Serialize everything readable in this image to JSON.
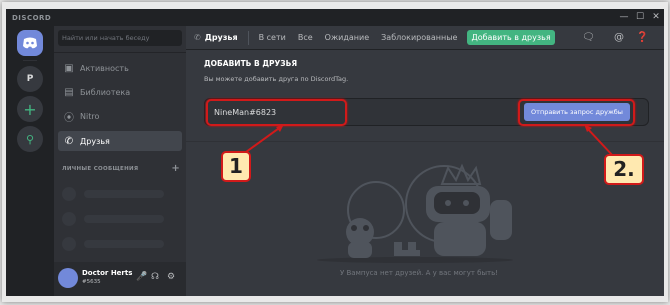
{
  "window": {
    "brand": "DISCORD",
    "controls": [
      "—",
      "☐",
      "✕"
    ]
  },
  "servers": [
    {
      "name": "home",
      "icon": "discord-logo-icon"
    },
    {
      "name": "P"
    },
    {
      "name": "add",
      "label": "+"
    },
    {
      "name": "explore",
      "icon": "search-icon"
    }
  ],
  "sidebar": {
    "search_placeholder": "Найти или начать беседу",
    "items": [
      {
        "label": "Активность",
        "icon": "gamepad-icon"
      },
      {
        "label": "Библиотека",
        "icon": "library-icon"
      },
      {
        "label": "Nitro",
        "icon": "nitro-icon"
      },
      {
        "label": "Друзья",
        "icon": "friends-icon",
        "active": true
      }
    ],
    "dm_header": "ЛИЧНЫЕ СООБЩЕНИЯ",
    "dm_add": "+"
  },
  "user": {
    "name": "Doctor Herts",
    "tag": "#5635"
  },
  "topbar": {
    "title": "Друзья",
    "tabs": [
      "В сети",
      "Все",
      "Ожидание",
      "Заблокированные"
    ],
    "add_friend": "Добавить в друзья"
  },
  "add_friend": {
    "title": "ДОБАВИТЬ В ДРУЗЬЯ",
    "subtitle": "Вы можете добавить друга по DiscordTag.",
    "input_value": "NineMan#6823",
    "button": "Отправить запрос дружбы"
  },
  "empty_state": "У Вампуса нет друзей. А у вас могут быть!",
  "annotations": {
    "step1": "1",
    "step2": "2."
  },
  "colors": {
    "accent": "#7289da",
    "green": "#43b581",
    "highlight": "#d11a1a"
  }
}
